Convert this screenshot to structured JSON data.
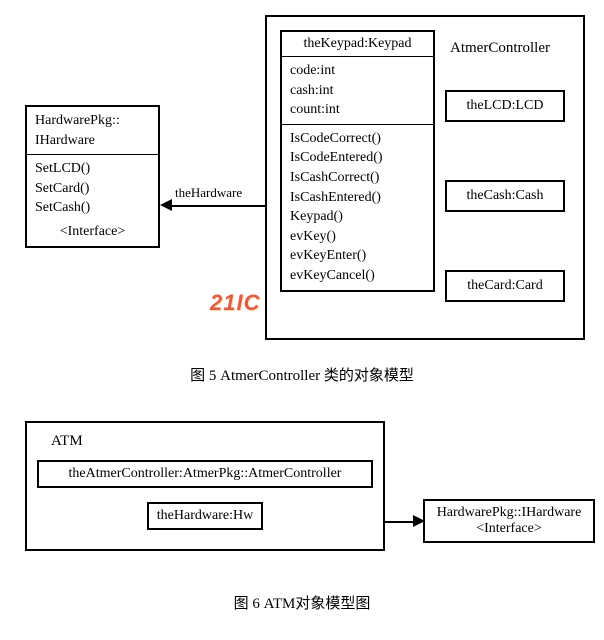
{
  "fig5": {
    "hardware": {
      "title": "HardwarePkg::",
      "title2": "IHardware",
      "ops": [
        "SetLCD()",
        "SetCard()",
        "SetCash()"
      ],
      "stereo": "<Interface>"
    },
    "keypad": {
      "title": "theKeypad:Keypad",
      "attrs": [
        "code:int",
        "cash:int",
        "count:int"
      ],
      "ops": [
        "IsCodeCorrect()",
        "IsCodeEntered()",
        "IsCashCorrect()",
        "IsCashEntered()",
        "Keypad()",
        "evKey()",
        "evKeyEnter()",
        "evKeyCancel()"
      ]
    },
    "controller": {
      "title": "AtmerController",
      "parts": [
        "theLCD:LCD",
        "theCash:Cash",
        "theCard:Card"
      ]
    },
    "assoc_label": "theHardware",
    "caption": "图 5  AtmerController 类的对象模型",
    "watermark": "21IC"
  },
  "fig6": {
    "atm_title": "ATM",
    "atm_inner1": "theAtmerController:AtmerPkg::AtmerController",
    "atm_inner2": "theHardware:Hw",
    "hw_box_line1": "HardwarePkg::IHardware",
    "hw_box_line2": "<Interface>",
    "caption": "图 6  ATM对象模型图"
  }
}
